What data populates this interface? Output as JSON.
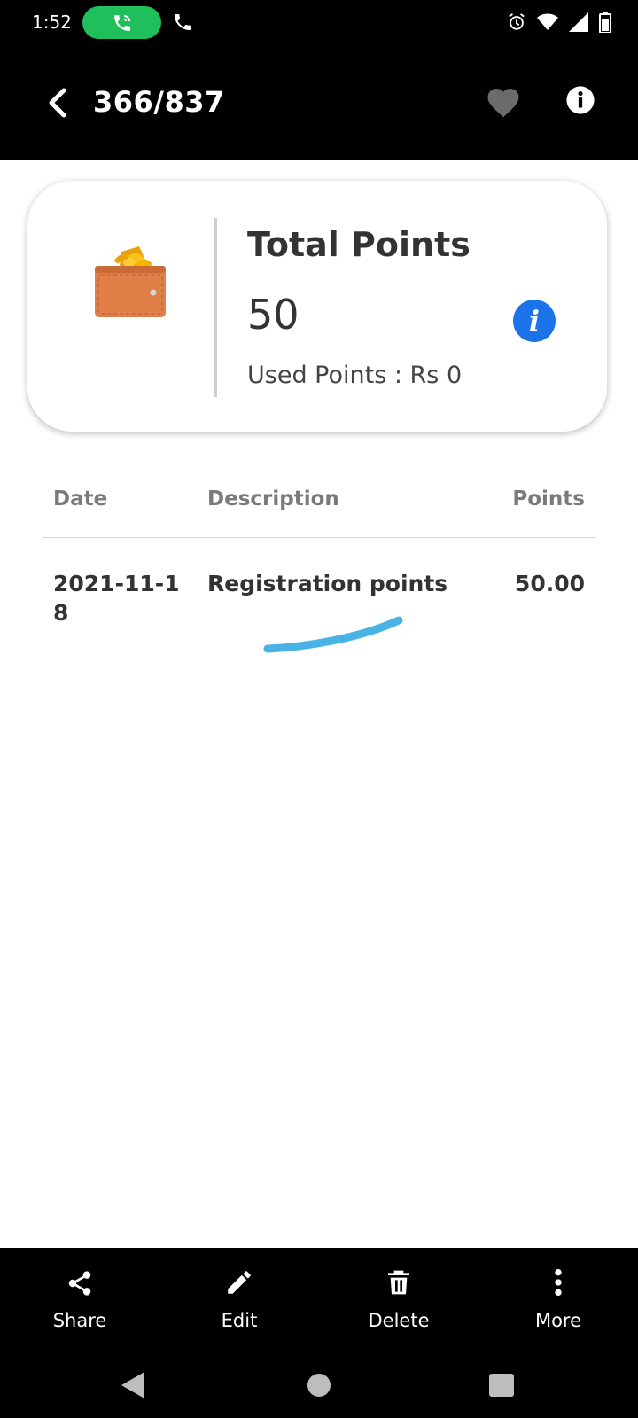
{
  "status_bar": {
    "time": "1:52",
    "icons": [
      "call-active-icon",
      "phone-icon",
      "alarm-icon",
      "wifi-icon",
      "signal-icon",
      "battery-icon"
    ]
  },
  "toolbar": {
    "title": "366/837",
    "icons": [
      "back-arrow-icon",
      "heart-icon",
      "info-icon"
    ]
  },
  "points_card": {
    "title": "Total Points",
    "value": "50",
    "used_label": "Used Points : Rs 0",
    "info_glyph": "i",
    "icons": [
      "wallet-coins-icon",
      "info-icon"
    ],
    "accent_color": "#1a73e8"
  },
  "table": {
    "headers": {
      "date": "Date",
      "description": "Description",
      "points": "Points"
    },
    "rows": [
      {
        "date": "2021-11-18",
        "description": "Registration points",
        "points": "50.00"
      }
    ]
  },
  "action_bar": {
    "items": [
      {
        "label": "Share",
        "icon": "share-icon"
      },
      {
        "label": "Edit",
        "icon": "pencil-icon"
      },
      {
        "label": "Delete",
        "icon": "trash-icon"
      },
      {
        "label": "More",
        "icon": "more-vertical-icon"
      }
    ]
  },
  "nav_bar": {
    "icons": [
      "nav-back-icon",
      "nav-home-icon",
      "nav-recents-icon"
    ]
  },
  "colors": {
    "call_pill": "#1fc05b",
    "scribble": "#4ab3e6"
  }
}
